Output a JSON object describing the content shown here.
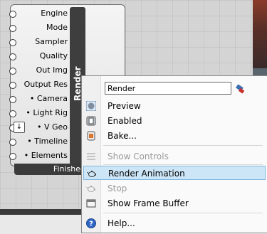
{
  "component": {
    "title": "Render",
    "inputs": [
      "Engine",
      "Mode",
      "Sampler",
      "Quality",
      "Out Img",
      "Output Res",
      "• Camera",
      "• Light Rig",
      "• V Geo",
      "• Timeline",
      "• Elements"
    ],
    "status": "Finished"
  },
  "menu": {
    "name_value": "Render",
    "items": {
      "preview": "Preview",
      "enabled": "Enabled",
      "bake": "Bake...",
      "show_controls": "Show Controls",
      "render_animation": "Render Animation",
      "stop": "Stop",
      "show_frame_buffer": "Show Frame Buffer",
      "help": "Help..."
    }
  },
  "icons": {
    "preview": "sphere-icon",
    "enabled": "component-icon",
    "bake": "bake-icon",
    "show_controls": "controls-icon",
    "render_animation": "teapot-icon",
    "stop": "teapot-stop-icon",
    "show_frame_buffer": "frame-buffer-icon",
    "help": "help-icon",
    "clear": "eraser-icon"
  },
  "colors": {
    "highlight": "#cde6f7",
    "highlight_border": "#7fb6df",
    "label_bar": "#3e3e3e"
  }
}
